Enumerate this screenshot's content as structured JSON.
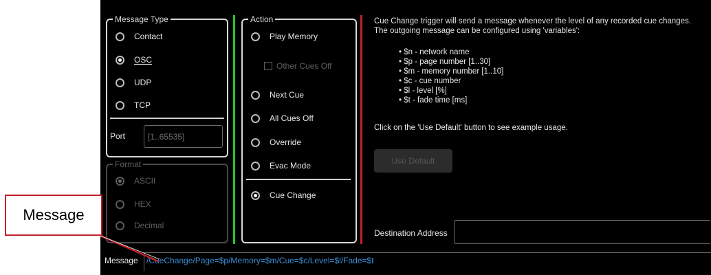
{
  "message_type": {
    "legend": "Message Type",
    "options": [
      {
        "label": "Contact",
        "selected": false
      },
      {
        "label": "OSC",
        "selected": true
      },
      {
        "label": "UDP",
        "selected": false
      },
      {
        "label": "TCP",
        "selected": false
      }
    ],
    "port_label": "Port",
    "port_placeholder": "[1..65535]"
  },
  "format": {
    "legend": "Format",
    "enabled": false,
    "options": [
      {
        "label": "ASCII",
        "selected": true
      },
      {
        "label": "HEX",
        "selected": false
      },
      {
        "label": "Decimal",
        "selected": false
      }
    ]
  },
  "action": {
    "legend": "Action",
    "options": [
      {
        "label": "Play Memory",
        "selected": false
      },
      {
        "label": "Next Cue",
        "selected": false
      },
      {
        "label": "All Cues Off",
        "selected": false
      },
      {
        "label": "Override",
        "selected": false
      },
      {
        "label": "Evac Mode",
        "selected": false
      },
      {
        "label": "Cue Change",
        "selected": true
      }
    ],
    "other_cues_off_label": "Other Cues Off",
    "other_cues_off_checked": false
  },
  "info": {
    "description": "Cue Change trigger will send a message whenever the level of any recorded cue changes. The outgoing message can be configured using 'variables':",
    "variables": [
      "$n - network name",
      "$p - page number [1..30]",
      "$m - memory number [1..10]",
      "$c - cue number",
      "$l - level [%]",
      "$t - fade time [ms]"
    ],
    "hint": "Click on the 'Use Default' button to see example usage.",
    "use_default_label": "Use Default",
    "destination_label": "Destination Address",
    "destination_value": ""
  },
  "message": {
    "label": "Message",
    "value": "/CueChange/Page=$p/Memory=$m/Cue=$c/Level=$l/Fade=$t"
  },
  "callout": {
    "text": "Message"
  },
  "colors": {
    "panel_bg": "#000000",
    "green_divider": "#22c92e",
    "red_divider": "#c8202a",
    "message_text": "#3a8fd8",
    "callout_border": "#c0202a"
  }
}
